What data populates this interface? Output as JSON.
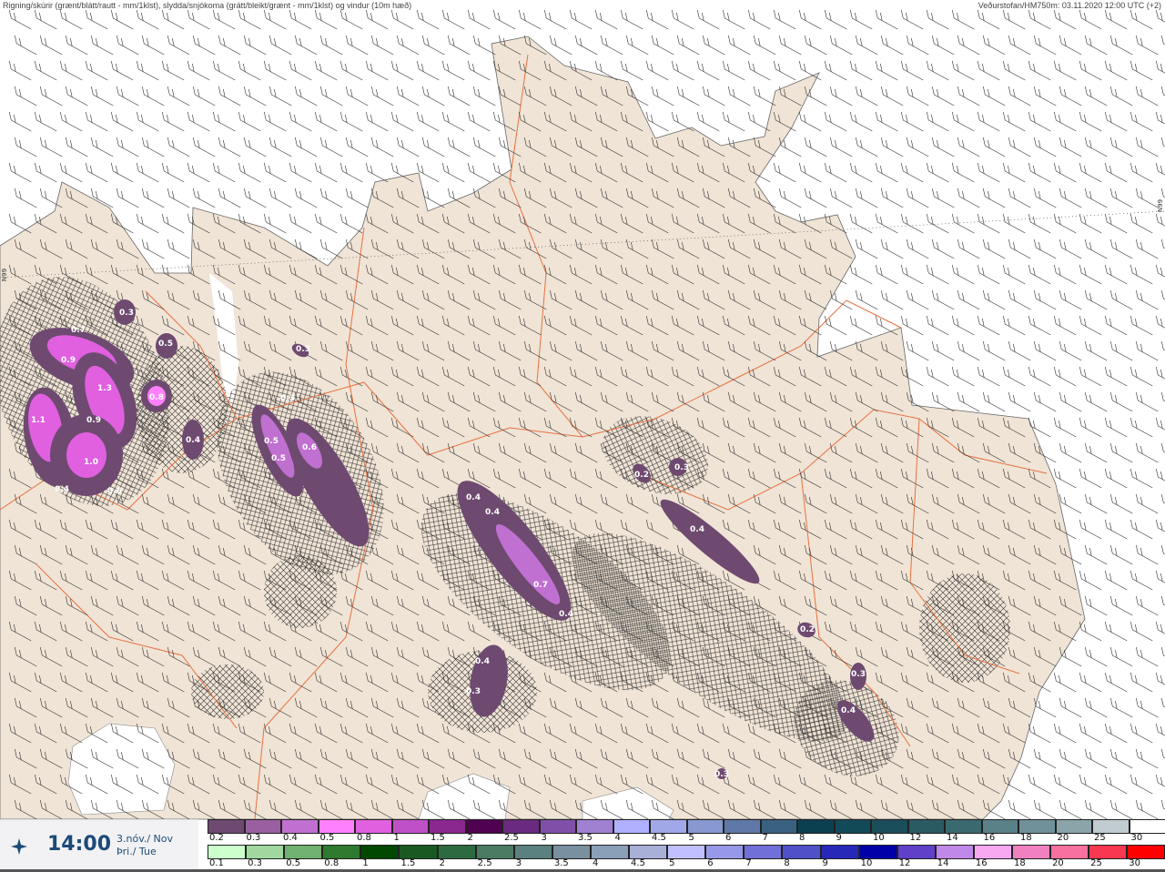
{
  "header": {
    "title": "Rigning/skúrir (grænt/blátt/rautt - mm/1klst), slydda/snjókoma (grátt/bleikt/grænt - mm/1klst) og vindur (10m hæð)",
    "source": "Veðurstofan/HM750m: 03.11.2020 12:00 UTC (+2)"
  },
  "side_labels": {
    "left": "N99",
    "right": "N99"
  },
  "time_panel": {
    "icon": "wind-compass-icon",
    "time": "14:00",
    "date_line1": "3.nóv./ Nov",
    "date_line2": "Þri./ Tue"
  },
  "legend": {
    "snow": {
      "labels": [
        "0.2",
        "0.3",
        "0.4",
        "0.5",
        "0.8",
        "1",
        "1.5",
        "2",
        "2.5",
        "3",
        "3.5",
        "4",
        "4.5",
        "5",
        "6",
        "7",
        "8",
        "9",
        "10",
        "12",
        "14",
        "16",
        "18",
        "20",
        "25",
        "30"
      ],
      "colors": [
        "#6e4a70",
        "#9a5fa0",
        "#c070d0",
        "#ff80ff",
        "#e060e0",
        "#c050c8",
        "#8a2890",
        "#500050",
        "#6a2a80",
        "#8050a8",
        "#a080d0",
        "#b0b0ff",
        "#a0a8e8",
        "#8898d0",
        "#6078a8",
        "#3a6080",
        "#0a4050",
        "#124a58",
        "#1a4e5a",
        "#2a5a62",
        "#3a6a70",
        "#5a8088",
        "#70909a",
        "#8aa4aa",
        "#c0ccd0",
        "#ffffff"
      ]
    },
    "rain": {
      "labels": [
        "0.1",
        "0.3",
        "0.5",
        "0.8",
        "1",
        "1.5",
        "2",
        "2.5",
        "3",
        "3.5",
        "4",
        "4.5",
        "5",
        "6",
        "7",
        "8",
        "9",
        "10",
        "12",
        "14",
        "16",
        "18",
        "20",
        "25",
        "30"
      ],
      "colors": [
        "#ccffcc",
        "#a0d8a0",
        "#70b070",
        "#2e7a2e",
        "#004800",
        "#1a5a22",
        "#2e6a40",
        "#4a7a60",
        "#5a8080",
        "#7890a0",
        "#8aa0b8",
        "#a8b0d8",
        "#c0c0ff",
        "#9898e8",
        "#7070d8",
        "#5050c8",
        "#2828b8",
        "#0000a8",
        "#6040c8",
        "#c088e8",
        "#f8a8f0",
        "#f080c0",
        "#f870a0",
        "#f83850",
        "#ff0000"
      ]
    }
  },
  "map": {
    "land_color": "#f0e4d6",
    "sea_color": "#ffffff",
    "road_color": "#e87040",
    "contour_labels": [
      "0.3",
      "0.7",
      "0.5",
      "0.9",
      "1.3",
      "0.8",
      "1.1",
      "0.9",
      "0.4",
      "1.0",
      "0.4",
      "0.6",
      "0.3",
      "0.3",
      "0.5",
      "0.6",
      "0.5",
      "0.4",
      "0.4",
      "0.7",
      "0.4",
      "0.4",
      "0.3",
      "0.2",
      "0.3",
      "0.4",
      "0.2",
      "0.3",
      "0.4",
      "0.3"
    ]
  }
}
